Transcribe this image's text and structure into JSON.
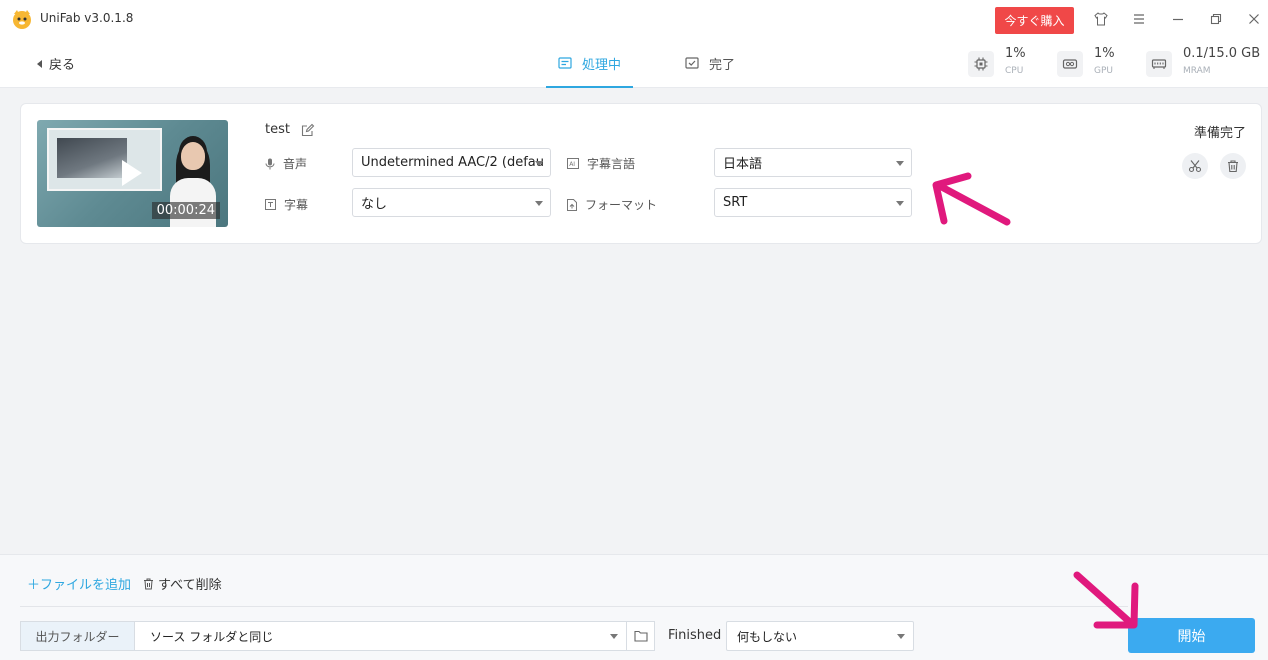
{
  "app": {
    "title": "UniFab v3.0.1.8",
    "buy_label": "今すぐ購入"
  },
  "titlebar_icons": [
    "shirt-icon",
    "menu-icon",
    "minimize-icon",
    "restore-icon",
    "close-icon"
  ],
  "nav": {
    "back_label": "戻る",
    "tabs": [
      {
        "label": "処理中",
        "active": true
      },
      {
        "label": "完了",
        "active": false
      }
    ],
    "stats": [
      {
        "value": "1%",
        "label": "CPU"
      },
      {
        "value": "1%",
        "label": "GPU"
      },
      {
        "value": "0.1/15.0 GB",
        "label": "MRAM"
      }
    ]
  },
  "task": {
    "file_name": "test",
    "duration": "00:00:24",
    "status": "準備完了",
    "audio_label": "音声",
    "audio_value": "Undetermined AAC/2 (defau",
    "subtitle_label": "字幕",
    "subtitle_value": "なし",
    "sub_lang_label": "字幕言語",
    "sub_lang_value": "日本語",
    "format_label": "フォーマット",
    "format_value": "SRT"
  },
  "bottom": {
    "add_file": "＋ファイルを追加",
    "delete_all": "すべて削除",
    "output_label": "出力フォルダー",
    "output_path": "ソース フォルダと同じ",
    "finished_label": "Finished",
    "finished_value": "何もしない",
    "start_label": "開始"
  },
  "colors": {
    "accent": "#2ea7e0",
    "buy": "#f04848",
    "start": "#3baaf0",
    "annotation": "#e0197d"
  }
}
